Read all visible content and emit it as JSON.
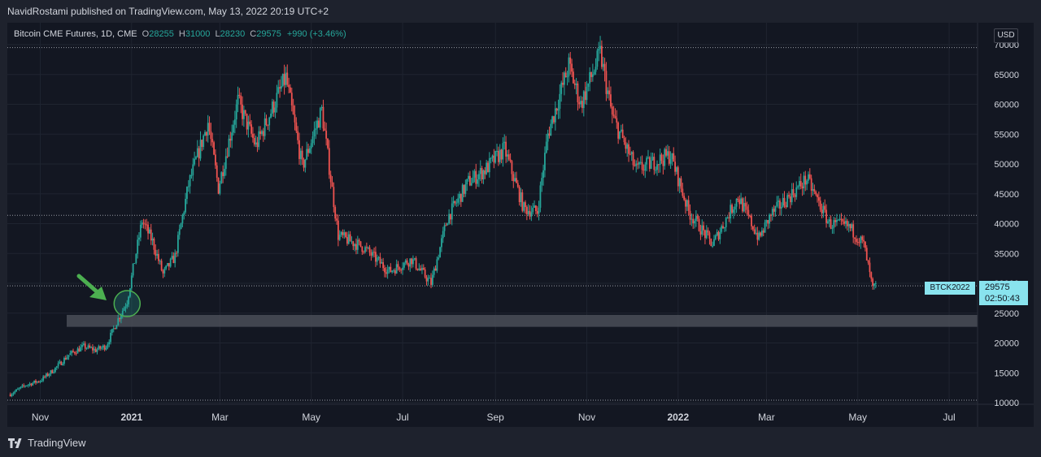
{
  "header": {
    "published": "NavidRostami published on TradingView.com, May 13, 2022 20:19 UTC+2"
  },
  "legend": {
    "symbol": "Bitcoin CME Futures, 1D, CME",
    "o_label": "O",
    "o_value": "28255",
    "h_label": "H",
    "h_value": "31000",
    "l_label": "L",
    "l_value": "28230",
    "c_label": "C",
    "c_value": "29575",
    "change": "+990 (+3.46%)"
  },
  "currency_button": "USD",
  "symbol_tag": "BTCK2022",
  "price_tag": {
    "price": "29575",
    "countdown": "02:50:43"
  },
  "brand": "TradingView",
  "colors": {
    "up": "#26a69a",
    "down": "#ef5350",
    "accent": "#89e3ee",
    "arrow": "#4caf50",
    "zone": "#4a4d57"
  },
  "chart_data": {
    "type": "candlestick",
    "x_range": [
      "2020-10-10",
      "2022-07-20"
    ],
    "y_range": [
      10000,
      70000
    ],
    "y_ticks": [
      10000,
      15000,
      20000,
      25000,
      30000,
      35000,
      40000,
      45000,
      50000,
      55000,
      60000,
      65000,
      70000
    ],
    "x_ticks": [
      {
        "label": "Nov",
        "date": "2020-11-01"
      },
      {
        "label": "2021",
        "date": "2021-01-01"
      },
      {
        "label": "Mar",
        "date": "2021-03-01"
      },
      {
        "label": "May",
        "date": "2021-05-01"
      },
      {
        "label": "Jul",
        "date": "2021-07-01"
      },
      {
        "label": "Sep",
        "date": "2021-09-01"
      },
      {
        "label": "Nov",
        "date": "2021-11-01"
      },
      {
        "label": "2022",
        "date": "2022-01-01"
      },
      {
        "label": "Mar",
        "date": "2022-03-01"
      },
      {
        "label": "May",
        "date": "2022-05-01"
      },
      {
        "label": "Jul",
        "date": "2022-07-01"
      }
    ],
    "dotted_lines": [
      69500,
      41400,
      29575,
      10400
    ],
    "support_zone": [
      22700,
      24700
    ],
    "last_close": 29575,
    "circle_marker": {
      "date": "2020-12-29",
      "price": 27000
    },
    "closes": [
      {
        "date": "2020-10-12",
        "close": 11400
      },
      {
        "date": "2020-10-22",
        "close": 12900
      },
      {
        "date": "2020-11-01",
        "close": 13700
      },
      {
        "date": "2020-11-10",
        "close": 15500
      },
      {
        "date": "2020-11-20",
        "close": 18000
      },
      {
        "date": "2020-11-30",
        "close": 19400
      },
      {
        "date": "2020-12-08",
        "close": 18800
      },
      {
        "date": "2020-12-15",
        "close": 19500
      },
      {
        "date": "2020-12-22",
        "close": 23500
      },
      {
        "date": "2020-12-29",
        "close": 27000
      },
      {
        "date": "2021-01-08",
        "close": 40500
      },
      {
        "date": "2021-01-15",
        "close": 37000
      },
      {
        "date": "2021-01-22",
        "close": 31500
      },
      {
        "date": "2021-01-30",
        "close": 34500
      },
      {
        "date": "2021-02-08",
        "close": 46500
      },
      {
        "date": "2021-02-21",
        "close": 57000
      },
      {
        "date": "2021-02-28",
        "close": 46000
      },
      {
        "date": "2021-03-13",
        "close": 60500
      },
      {
        "date": "2021-03-25",
        "close": 53000
      },
      {
        "date": "2021-04-14",
        "close": 64500
      },
      {
        "date": "2021-04-25",
        "close": 49500
      },
      {
        "date": "2021-05-08",
        "close": 59000
      },
      {
        "date": "2021-05-19",
        "close": 38000
      },
      {
        "date": "2021-06-05",
        "close": 36000
      },
      {
        "date": "2021-06-22",
        "close": 32000
      },
      {
        "date": "2021-07-07",
        "close": 34000
      },
      {
        "date": "2021-07-20",
        "close": 30000
      },
      {
        "date": "2021-07-31",
        "close": 41000
      },
      {
        "date": "2021-08-14",
        "close": 47000
      },
      {
        "date": "2021-08-25",
        "close": 49000
      },
      {
        "date": "2021-09-07",
        "close": 52500
      },
      {
        "date": "2021-09-20",
        "close": 42500
      },
      {
        "date": "2021-09-29",
        "close": 42000
      },
      {
        "date": "2021-10-06",
        "close": 55000
      },
      {
        "date": "2021-10-20",
        "close": 66500
      },
      {
        "date": "2021-10-28",
        "close": 60000
      },
      {
        "date": "2021-11-10",
        "close": 68500
      },
      {
        "date": "2021-11-18",
        "close": 58000
      },
      {
        "date": "2021-12-04",
        "close": 49000
      },
      {
        "date": "2021-12-27",
        "close": 51500
      },
      {
        "date": "2022-01-08",
        "close": 42000
      },
      {
        "date": "2022-01-24",
        "close": 36500
      },
      {
        "date": "2022-02-10",
        "close": 44500
      },
      {
        "date": "2022-02-24",
        "close": 37500
      },
      {
        "date": "2022-03-04",
        "close": 41500
      },
      {
        "date": "2022-03-28",
        "close": 47500
      },
      {
        "date": "2022-04-12",
        "close": 40000
      },
      {
        "date": "2022-04-25",
        "close": 39500
      },
      {
        "date": "2022-05-05",
        "close": 36500
      },
      {
        "date": "2022-05-11",
        "close": 29000
      },
      {
        "date": "2022-05-13",
        "close": 29575
      }
    ]
  }
}
